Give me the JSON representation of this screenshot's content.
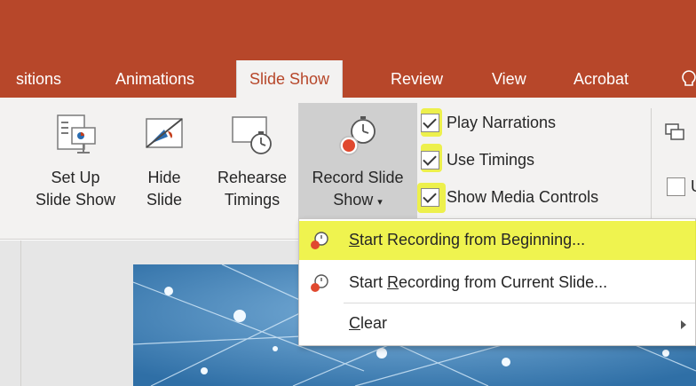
{
  "tabs": {
    "transitions": "sitions",
    "animations": "Animations",
    "slide_show": "Slide Show",
    "review": "Review",
    "view": "View",
    "acrobat": "Acrobat"
  },
  "ribbon": {
    "setup_line1": "Set Up",
    "setup_line2": "Slide Show",
    "hide_line1": "Hide",
    "hide_line2": "Slide",
    "rehearse_line1": "Rehearse",
    "rehearse_line2": "Timings",
    "record_line1": "Record Slide",
    "record_line2": "Show",
    "play_narrations": "Play Narrations",
    "use_timings": "Use Timings",
    "show_media_controls": "Show Media Controls",
    "cut_label": "U"
  },
  "menu": {
    "item1_key": "S",
    "item1_rest": "tart Recording from Beginning...",
    "item2_pre": "Start ",
    "item2_key": "R",
    "item2_rest": "ecording from Current Slide...",
    "item3_key": "C",
    "item3_rest": "lear"
  },
  "colors": {
    "accent": "#b7472a",
    "highlight": "#ebf01e",
    "slide_bg": "#3d7fb5"
  },
  "icons": {
    "help": "lightbulb-icon",
    "setup": "setup-slideshow-icon",
    "hide": "hide-slide-icon",
    "rehearse": "rehearse-timings-icon",
    "record": "record-slideshow-icon",
    "record_menu": "record-stopwatch-icon",
    "submenu": "chevron-right-icon"
  }
}
